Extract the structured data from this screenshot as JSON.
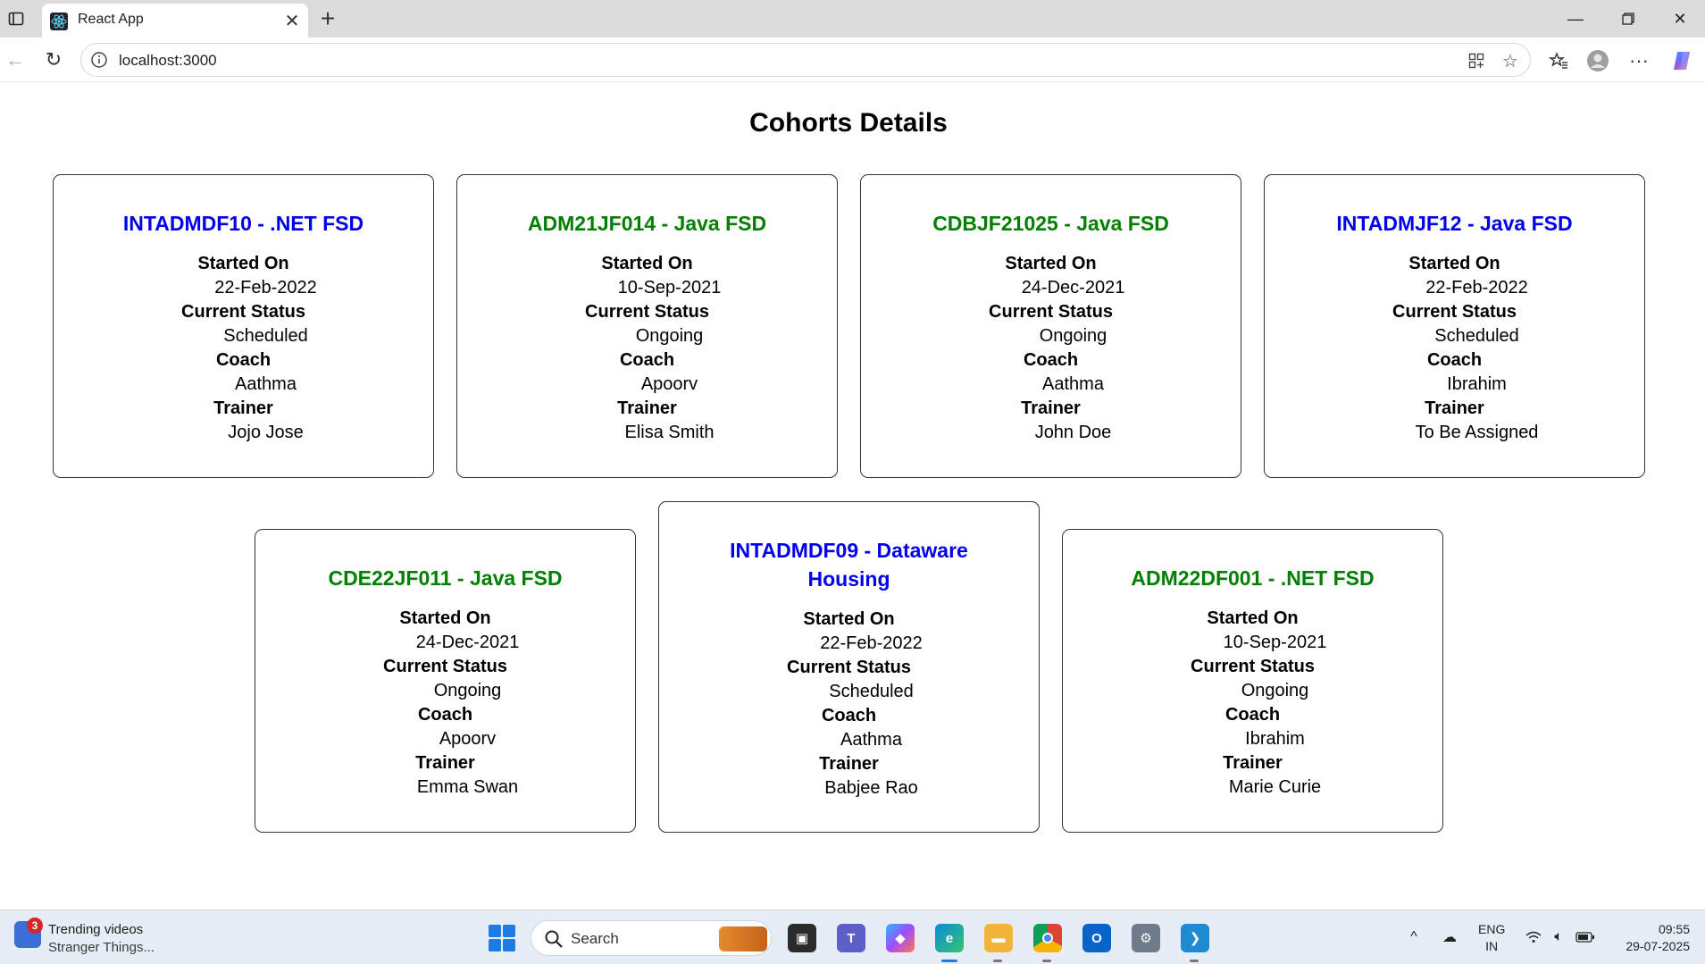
{
  "browser": {
    "tab_title": "React App",
    "url": "localhost:3000",
    "icons": [
      "sidebar-icon",
      "react-icon",
      "close-icon",
      "plus-icon",
      "minimize-icon",
      "restore-icon",
      "window-close-icon",
      "back-icon",
      "reload-icon",
      "info-icon",
      "apps-icon",
      "star-icon",
      "favorites-icon",
      "profile-icon",
      "more-icon",
      "copilot-icon"
    ]
  },
  "page": {
    "title": "Cohorts Details",
    "labels": {
      "started_on": "Started On",
      "current_status": "Current Status",
      "coach": "Coach",
      "trainer": "Trainer"
    },
    "colors": {
      "scheduled": "#0000ee",
      "ongoing": "#008000"
    },
    "cohorts": [
      {
        "title": "INTADMDF10 - .NET FSD",
        "started_on": "22-Feb-2022",
        "status": "Scheduled",
        "coach": "Aathma",
        "trainer": "Jojo Jose"
      },
      {
        "title": "ADM21JF014 - Java FSD",
        "started_on": "10-Sep-2021",
        "status": "Ongoing",
        "coach": "Apoorv",
        "trainer": "Elisa Smith"
      },
      {
        "title": "CDBJF21025 - Java FSD",
        "started_on": "24-Dec-2021",
        "status": "Ongoing",
        "coach": "Aathma",
        "trainer": "John Doe"
      },
      {
        "title": "INTADMJF12 - Java FSD",
        "started_on": "22-Feb-2022",
        "status": "Scheduled",
        "coach": "Ibrahim",
        "trainer": "To Be Assigned"
      },
      {
        "title": "CDE22JF011 - Java FSD",
        "started_on": "24-Dec-2021",
        "status": "Ongoing",
        "coach": "Apoorv",
        "trainer": "Emma Swan"
      },
      {
        "title": "INTADMDF09 - Dataware Housing",
        "started_on": "22-Feb-2022",
        "status": "Scheduled",
        "coach": "Aathma",
        "trainer": "Babjee Rao"
      },
      {
        "title": "ADM22DF001 - .NET FSD",
        "started_on": "10-Sep-2021",
        "status": "Ongoing",
        "coach": "Ibrahim",
        "trainer": "Marie Curie"
      }
    ]
  },
  "taskbar": {
    "news_badge": "3",
    "news_title": "Trending videos",
    "news_subtitle": "Stranger Things...",
    "search_placeholder": "Search",
    "lang_line1": "ENG",
    "lang_line2": "IN",
    "time": "09:55",
    "date": "29-07-2025"
  }
}
